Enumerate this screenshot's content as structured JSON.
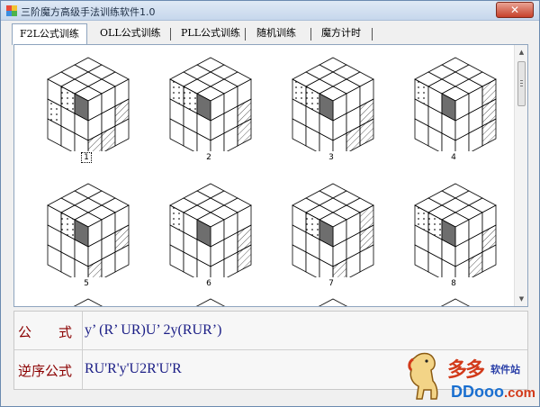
{
  "window": {
    "title": "三阶魔方高级手法训练软件1.0",
    "close_label": "✕"
  },
  "tabs": [
    {
      "label": "F2L公式训练",
      "active": true
    },
    {
      "label": "OLL公式训练",
      "active": false
    },
    {
      "label": "PLL公式训练",
      "active": false
    },
    {
      "label": "随机训练",
      "active": false
    },
    {
      "label": "魔方计时",
      "active": false
    }
  ],
  "cases": [
    {
      "label": "1",
      "focused": true,
      "dark": [
        4
      ],
      "dots": [
        1,
        2,
        3
      ],
      "hatch": [
        5,
        6,
        7
      ]
    },
    {
      "label": "2",
      "focused": false,
      "dark": [
        4
      ],
      "dots": [
        0,
        1,
        2
      ],
      "hatch": [
        5,
        8
      ]
    },
    {
      "label": "3",
      "focused": false,
      "dark": [
        4
      ],
      "dots": [
        0,
        1
      ],
      "hatch": [
        5,
        7,
        8
      ]
    },
    {
      "label": "4",
      "focused": false,
      "dark": [
        4
      ],
      "dots": [
        0
      ],
      "hatch": [
        2,
        5,
        8
      ]
    },
    {
      "label": "5",
      "focused": false,
      "dark": [
        4
      ],
      "dots": [
        1,
        2
      ],
      "hatch": [
        5,
        6
      ]
    },
    {
      "label": "6",
      "focused": false,
      "dark": [
        4
      ],
      "dots": [
        0,
        2
      ],
      "hatch": [
        5,
        8
      ]
    },
    {
      "label": "7",
      "focused": false,
      "dark": [
        4
      ],
      "dots": [
        1
      ],
      "hatch": [
        2,
        5,
        6
      ]
    },
    {
      "label": "8",
      "focused": false,
      "dark": [
        4
      ],
      "dots": [
        0,
        1,
        2
      ],
      "hatch": [
        5,
        7
      ]
    }
  ],
  "formula": {
    "label": "公　　式",
    "value": "y’ (R’ UR)U’ 2y(RUR’)"
  },
  "reverse": {
    "label": "逆序公式",
    "value": "RU'R'y'U2R'U'R"
  },
  "watermark": {
    "brand_zh": "多多",
    "brand_sub": "软件站",
    "url_main": "DDooo",
    "url_tld": ".com"
  },
  "colors": {
    "formula_label": "#8b0000",
    "formula_value": "#1b1e86",
    "window_border": "#6b8ab0",
    "close_button": "#c6402a"
  },
  "icons": {
    "app": "app-grid-icon",
    "close": "close-icon",
    "scroll_up": "scroll-up-icon",
    "scroll_down": "scroll-down-icon"
  }
}
